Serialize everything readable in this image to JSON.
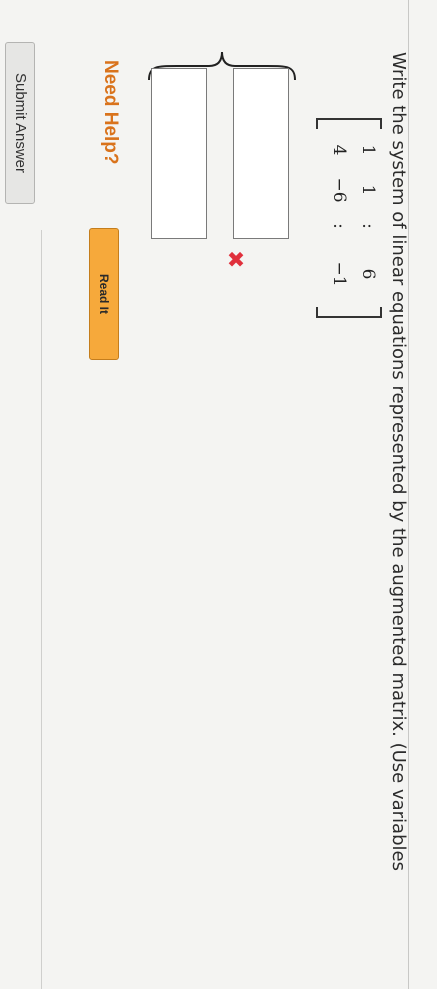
{
  "question": {
    "text": "Write the system of linear equations represented by the augmented matrix. (Use variables"
  },
  "matrix": {
    "rows": [
      [
        "1",
        "1",
        ":",
        "6"
      ],
      [
        "4",
        "−6",
        ":",
        "−1"
      ]
    ]
  },
  "answer": {
    "status_icon": "x-mark-icon",
    "status_glyph": "✖",
    "status_color": "#e0303c",
    "box1_value": "",
    "box2_value": ""
  },
  "help": {
    "label": "Need Help?",
    "read_it": "Read It"
  },
  "submit": {
    "label": "Submit Answer"
  }
}
